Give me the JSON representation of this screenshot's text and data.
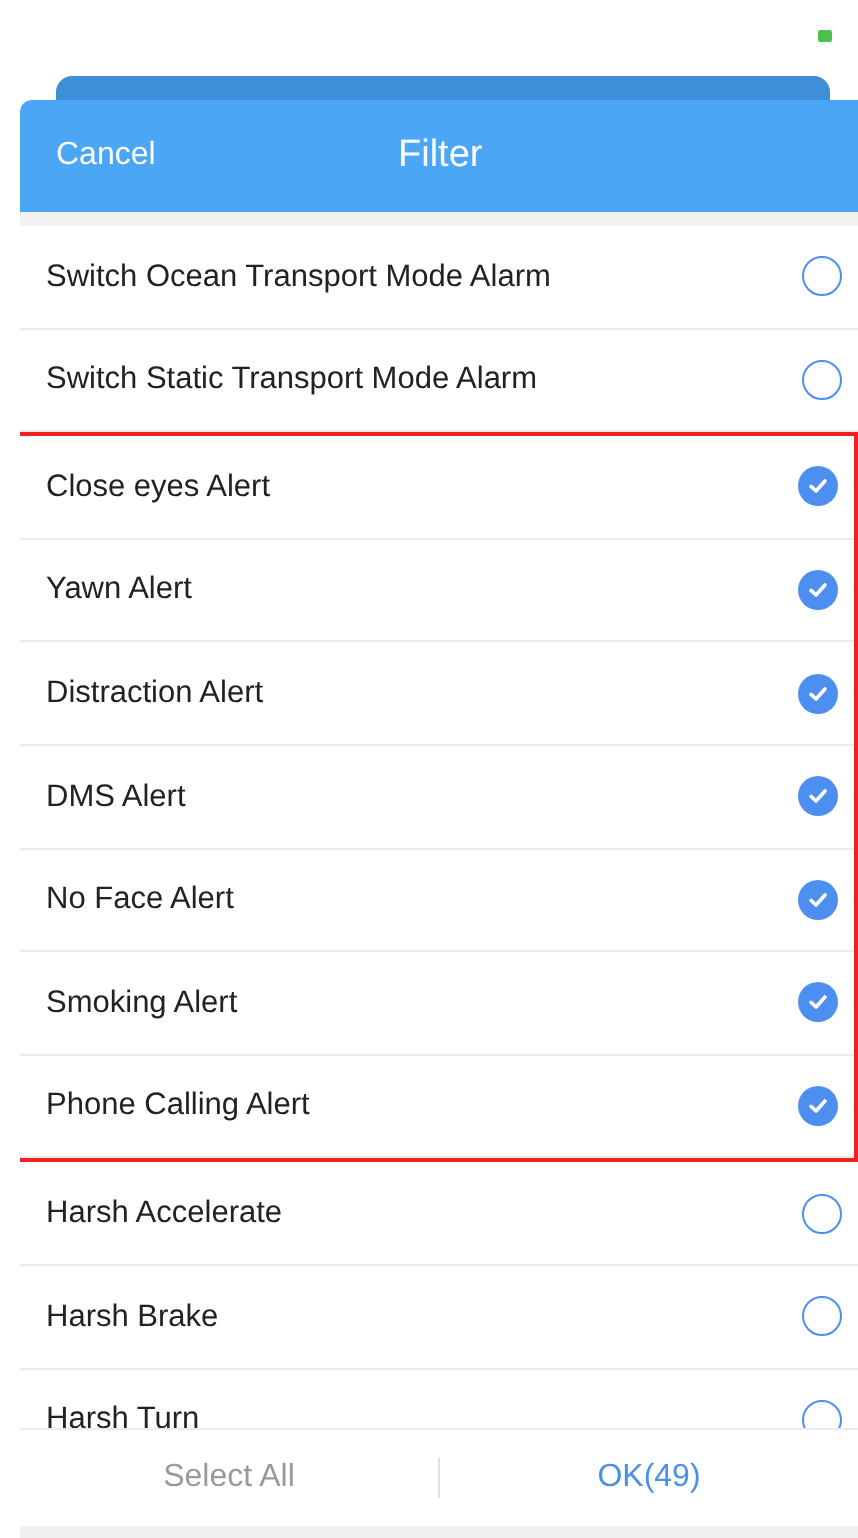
{
  "header": {
    "cancel": "Cancel",
    "title": "Filter"
  },
  "items": [
    {
      "label": "Switch Ocean Transport Mode Alarm",
      "checked": false,
      "highlighted": false
    },
    {
      "label": "Switch Static Transport Mode Alarm",
      "checked": false,
      "highlighted": false
    },
    {
      "label": "Close eyes Alert",
      "checked": true,
      "highlighted": true
    },
    {
      "label": "Yawn Alert",
      "checked": true,
      "highlighted": true
    },
    {
      "label": "Distraction Alert",
      "checked": true,
      "highlighted": true
    },
    {
      "label": "DMS Alert",
      "checked": true,
      "highlighted": true
    },
    {
      "label": "No Face Alert",
      "checked": true,
      "highlighted": true
    },
    {
      "label": "Smoking Alert",
      "checked": true,
      "highlighted": true
    },
    {
      "label": "Phone Calling Alert",
      "checked": true,
      "highlighted": true
    },
    {
      "label": "Harsh Accelerate",
      "checked": false,
      "highlighted": false
    },
    {
      "label": "Harsh Brake",
      "checked": false,
      "highlighted": false
    },
    {
      "label": "Harsh Turn",
      "checked": false,
      "highlighted": false
    }
  ],
  "footer": {
    "select_all": "Select All",
    "ok": "OK(49)"
  }
}
